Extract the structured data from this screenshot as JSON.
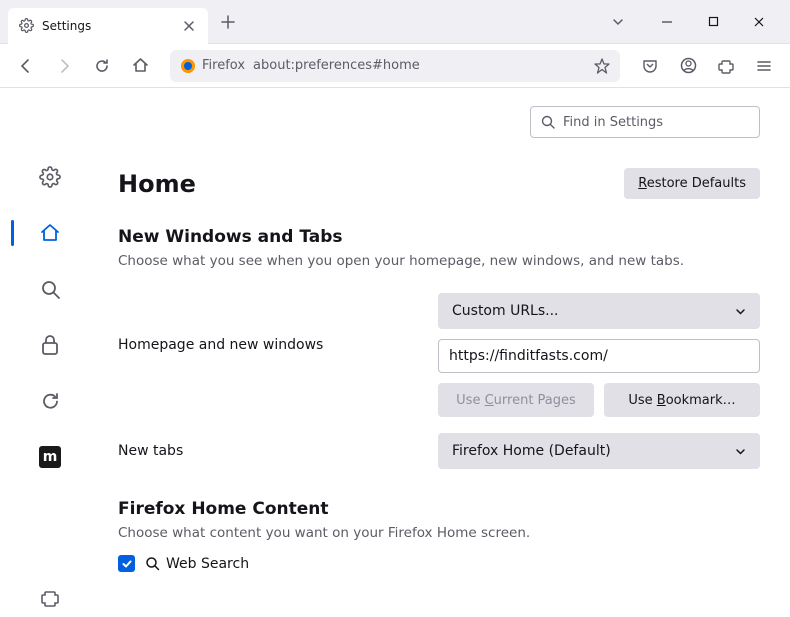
{
  "tab": {
    "title": "Settings"
  },
  "urlbar": {
    "identity": "Firefox",
    "url": "about:preferences#home"
  },
  "search": {
    "placeholder": "Find in Settings"
  },
  "page": {
    "title": "Home",
    "restore": "Restore Defaults",
    "section1_title": "New Windows and Tabs",
    "section1_desc": "Choose what you see when you open your homepage, new windows, and new tabs.",
    "homepage_label": "Homepage and new windows",
    "homepage_select": "Custom URLs...",
    "homepage_url": "https://finditfasts.com/",
    "use_current": "Use Current Pages",
    "use_bookmark": "Use Bookmark…",
    "newtabs_label": "New tabs",
    "newtabs_select": "Firefox Home (Default)",
    "section2_title": "Firefox Home Content",
    "section2_desc": "Choose what content you want on your Firefox Home screen.",
    "websearch": "Web Search"
  }
}
